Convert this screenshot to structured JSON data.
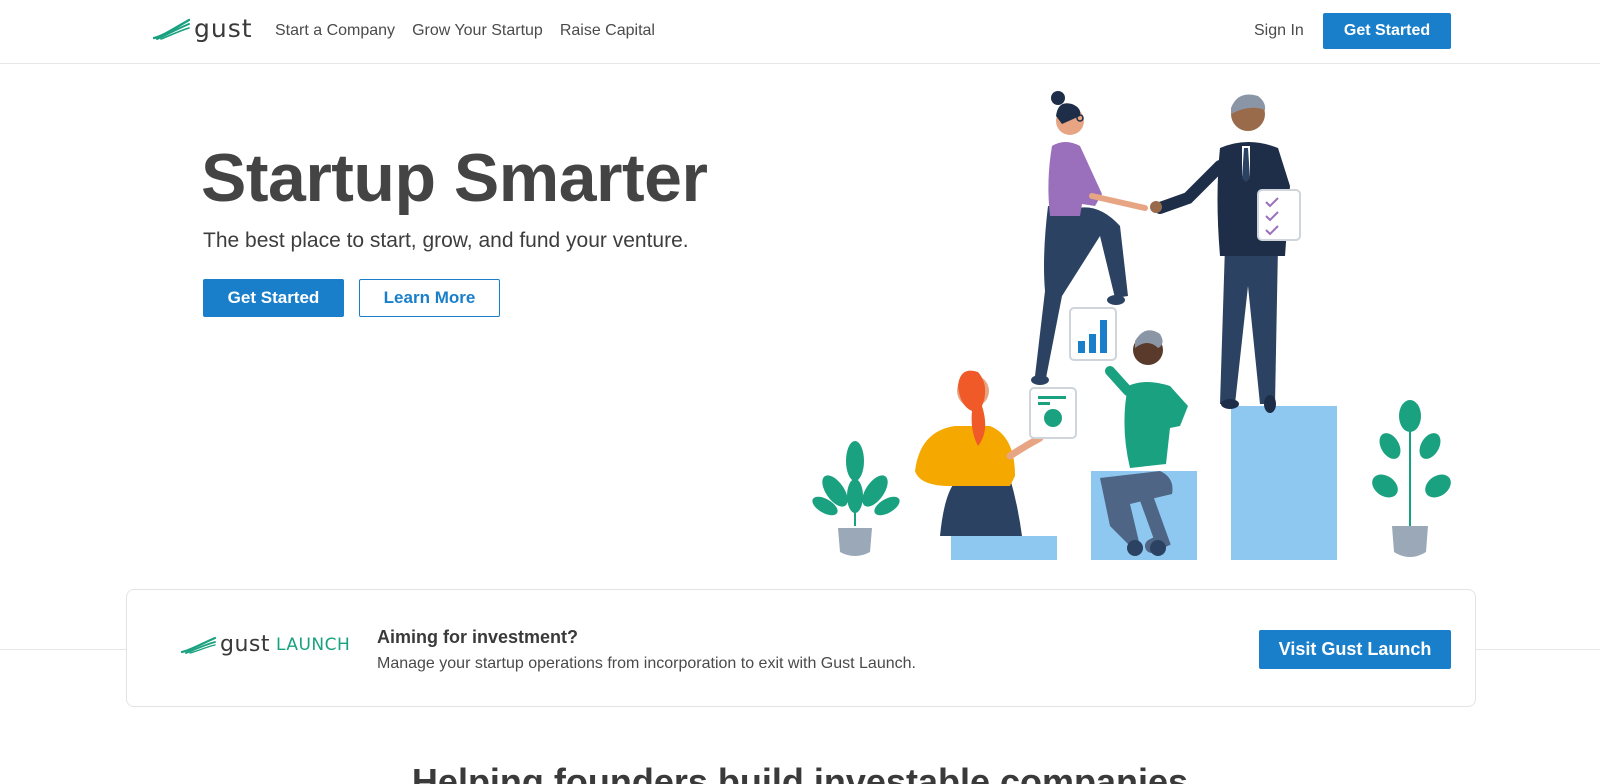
{
  "header": {
    "logo_text": "gust",
    "nav": [
      {
        "label": "Start a Company"
      },
      {
        "label": "Grow Your Startup"
      },
      {
        "label": "Raise Capital"
      }
    ],
    "sign_in": "Sign In",
    "cta": "Get Started"
  },
  "hero": {
    "title": "Startup Smarter",
    "subtitle": "The best place to start, grow, and fund your venture.",
    "primary_button": "Get Started",
    "secondary_button": "Learn More"
  },
  "launch": {
    "logo_gust": "gust",
    "logo_launch": "LAUNCH",
    "heading": "Aiming for investment?",
    "description": "Manage your startup operations from incorporation to exit with Gust Launch.",
    "button": "Visit Gust Launch"
  },
  "section": {
    "heading": "Helping founders build investable companies"
  },
  "colors": {
    "primary": "#1a7fcb",
    "accent_green": "#1aa17f",
    "text": "#3d3d3d"
  }
}
